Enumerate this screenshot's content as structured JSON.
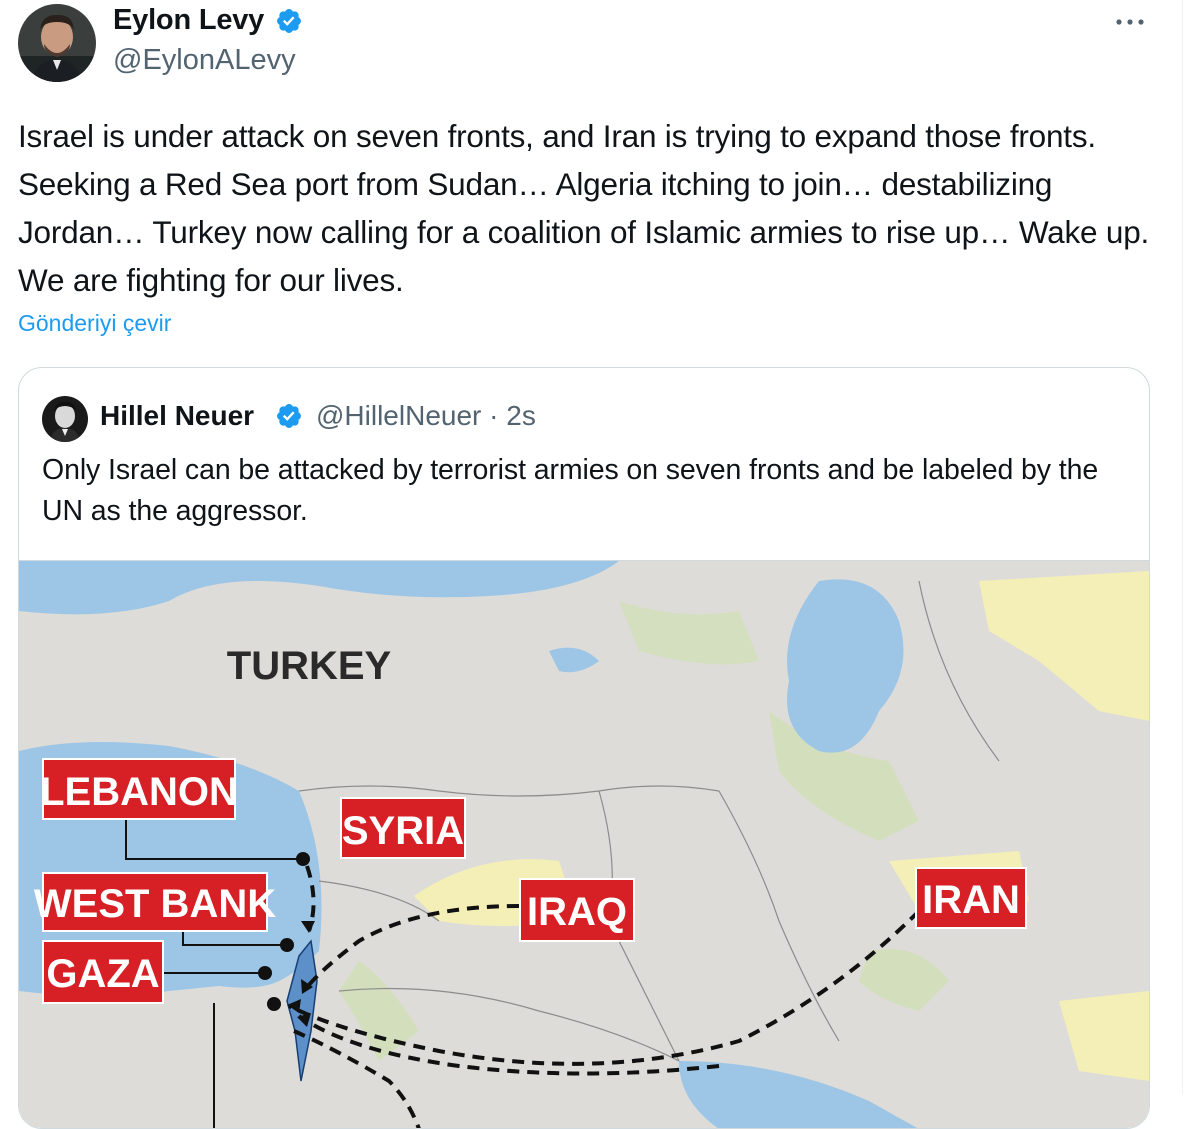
{
  "tweet": {
    "author": {
      "name": "Eylon Levy",
      "handle": "@EylonALevy",
      "verified": true
    },
    "text": "Israel is under attack on seven fronts, and Iran is trying to expand those fronts. Seeking a Red Sea port from Sudan… Algeria itching to join… destabilizing Jordan… Turkey now calling for a coalition of Islamic armies to rise up… Wake up. We are fighting for our lives.",
    "translate_label": "Gönderiyi çevir",
    "more_icon": "more-icon"
  },
  "quote": {
    "author": {
      "name": "Hillel Neuer",
      "handle": "@HillelNeuer · 2s",
      "verified": true
    },
    "text": "Only Israel can be attacked by terrorist armies on seven fronts and be labeled by the UN as the aggressor.",
    "map": {
      "labels": {
        "turkey": "TURKEY",
        "lebanon": "LEBANON",
        "syria": "SYRIA",
        "west_bank": "WEST BANK",
        "iraq": "IRAQ",
        "iran": "IRAN",
        "gaza": "GAZA"
      }
    }
  },
  "colors": {
    "accent": "#1d9bf0",
    "secondary_text": "#536471",
    "map_label_bg": "#d71f26"
  }
}
